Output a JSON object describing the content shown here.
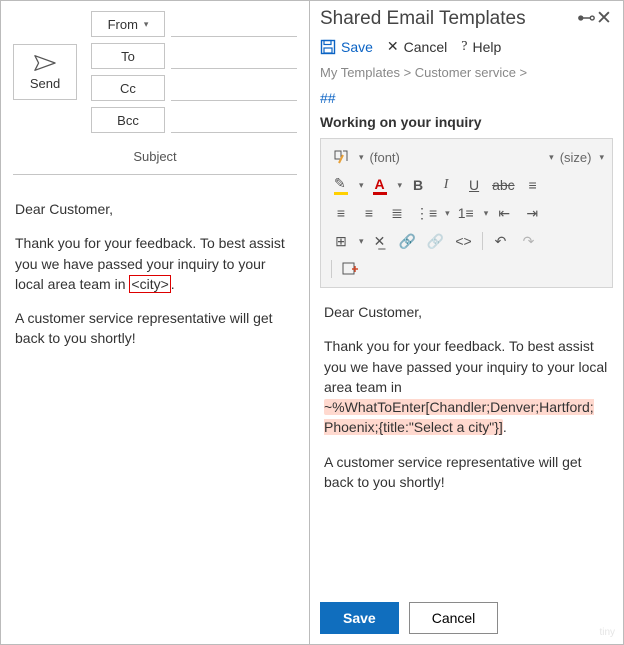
{
  "compose": {
    "send": "Send",
    "from": "From",
    "to": "To",
    "cc": "Cc",
    "bcc": "Bcc",
    "subject": "Subject",
    "body": {
      "greeting": "Dear Customer,",
      "p1a": "Thank you for your feedback. To best assist you we have passed your inquiry to your local area team in ",
      "placeholder": "<city>",
      "p1b": ".",
      "p2": "A customer service representative will get back to you shortly!"
    }
  },
  "pane": {
    "title": "Shared Email Templates",
    "save": "Save",
    "cancel": "Cancel",
    "help": "Help",
    "crumb1": "My Templates",
    "crumb2": "Customer service",
    "crumb_sep": " > ",
    "hash": "##",
    "template_name": "Working on your inquiry",
    "toolbar": {
      "font": "(font)",
      "size": "(size)",
      "bold": "B",
      "italic": "I",
      "underline": "U",
      "strike": "abc"
    },
    "body": {
      "greeting": "Dear Customer,",
      "p1a": "Thank you for your feedback. To best assist you we have passed your inquiry to your local area team in",
      "macro": "~%WhatToEnter[Chandler;Denver;Hartford;\nPhoenix;{title:\"Select a city\"}]",
      "p1b": ".",
      "p2": "A customer service representative will get back to you shortly!"
    },
    "btn_save": "Save",
    "btn_cancel": "Cancel"
  },
  "watermark": "tiny"
}
